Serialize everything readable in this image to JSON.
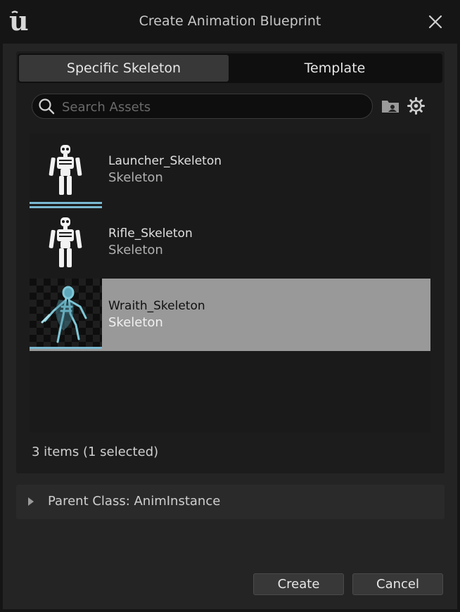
{
  "window": {
    "title": "Create Animation Blueprint"
  },
  "tabs": [
    {
      "label": "Specific Skeleton",
      "active": true
    },
    {
      "label": "Template",
      "active": false
    }
  ],
  "search": {
    "placeholder": "Search Assets",
    "value": ""
  },
  "assets": [
    {
      "name": "Launcher_Skeleton",
      "type": "Skeleton",
      "selected": false
    },
    {
      "name": "Rifle_Skeleton",
      "type": "Skeleton",
      "selected": false
    },
    {
      "name": "Wraith_Skeleton",
      "type": "Skeleton",
      "selected": true
    }
  ],
  "status": {
    "text": "3 items (1 selected)"
  },
  "parent_class": {
    "label": "Parent Class: AnimInstance"
  },
  "buttons": {
    "create": "Create",
    "cancel": "Cancel"
  },
  "colors": {
    "accent": "#7ab8d0",
    "selection": "#999999",
    "background": "#151515"
  },
  "icons": [
    "unreal-logo-icon",
    "close-icon",
    "search-icon",
    "folder-icon",
    "gear-icon",
    "skeleton-icon",
    "caret-right-icon"
  ]
}
